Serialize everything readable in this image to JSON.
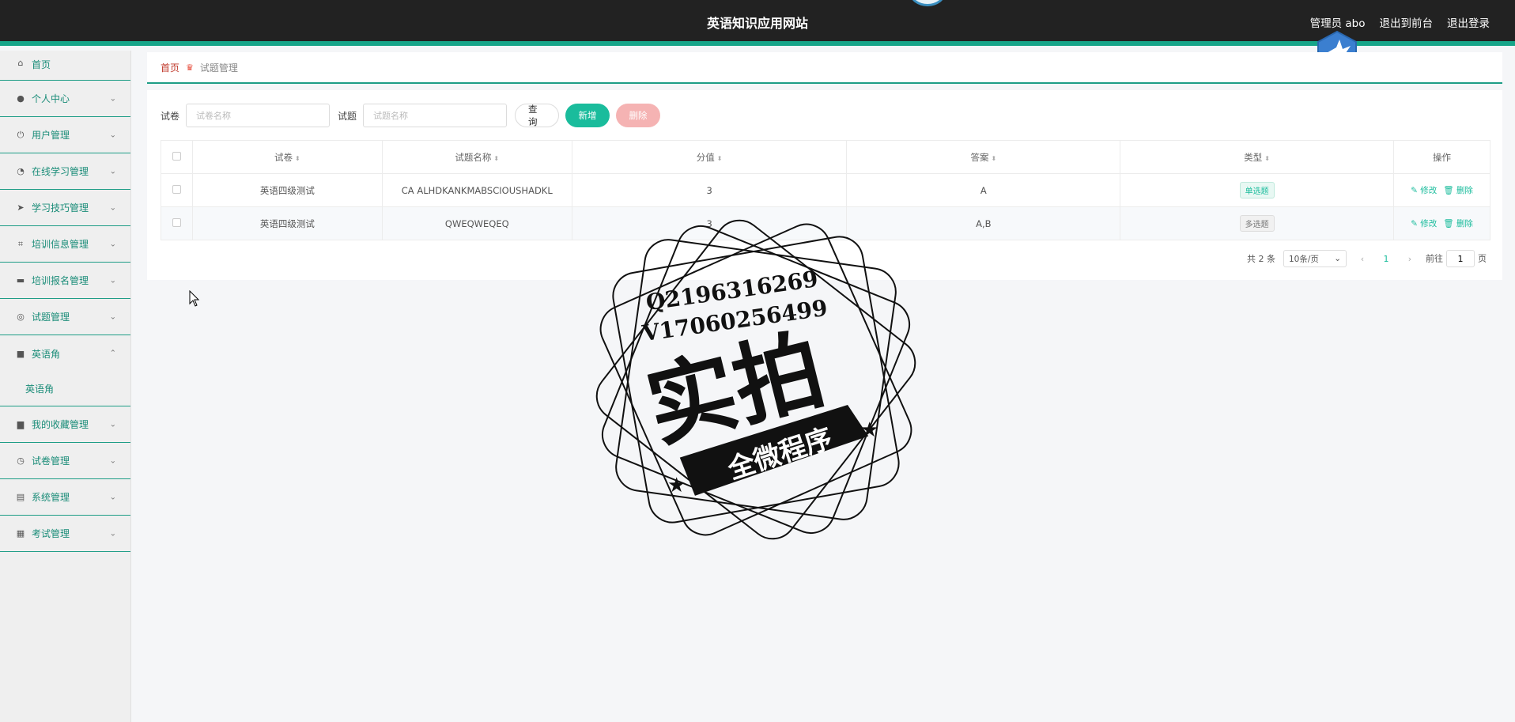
{
  "header": {
    "site_title": "英语知识应用网站",
    "user_label": "管理员 abo",
    "to_front_label": "退出到前台",
    "logout_label": "退出登录"
  },
  "sidebar": {
    "items": [
      {
        "label": "首页",
        "icon": "home-icon"
      },
      {
        "label": "个人中心",
        "icon": "user-icon"
      },
      {
        "label": "用户管理",
        "icon": "power-icon"
      },
      {
        "label": "在线学习管理",
        "icon": "dashboard-icon"
      },
      {
        "label": "学习技巧管理",
        "icon": "send-icon"
      },
      {
        "label": "培训信息管理",
        "icon": "crop-icon"
      },
      {
        "label": "培训报名管理",
        "icon": "chat-icon"
      },
      {
        "label": "试题管理",
        "icon": "globe-icon"
      },
      {
        "label": "英语角",
        "icon": "briefcase-icon"
      },
      {
        "label": "我的收藏管理",
        "icon": "box-icon"
      },
      {
        "label": "试卷管理",
        "icon": "clock-icon"
      },
      {
        "label": "系统管理",
        "icon": "document-icon"
      },
      {
        "label": "考试管理",
        "icon": "clipboard-icon"
      }
    ],
    "submenu": {
      "label": "英语角"
    }
  },
  "breadcrumb": {
    "home": "首页",
    "current": "试题管理"
  },
  "filters": {
    "paper_label": "试卷",
    "paper_placeholder": "试卷名称",
    "question_label": "试题",
    "question_placeholder": "试题名称",
    "query_label": "查询",
    "add_label": "新增",
    "delete_label": "删除"
  },
  "table": {
    "columns": [
      "试卷",
      "试题名称",
      "分值",
      "答案",
      "类型",
      "操作"
    ],
    "rows": [
      {
        "paper": "英语四级测试",
        "name": "CA ALHDKANKMABSCIOUSHADKL",
        "score": "3",
        "answer": "A",
        "type": "单选题"
      },
      {
        "paper": "英语四级测试",
        "name": "QWEQWEQEQ",
        "score": "3",
        "answer": "A,B",
        "type": "多选题"
      }
    ],
    "edit_label": "修改",
    "delete_label": "删除"
  },
  "pagination": {
    "total": "共 2 条",
    "page_size": "10条/页",
    "current_page": "1",
    "goto_prefix": "前往",
    "goto_value": "1",
    "goto_suffix": "页"
  },
  "watermark": {
    "line1": "Q2196316269",
    "line2": "V17060256499",
    "main": "实拍",
    "banner": "全微程序"
  },
  "colors": {
    "accent": "#1abc9c",
    "header_bg": "#222222",
    "menu_text": "#1a8c78",
    "danger": "#f5b3b3"
  }
}
